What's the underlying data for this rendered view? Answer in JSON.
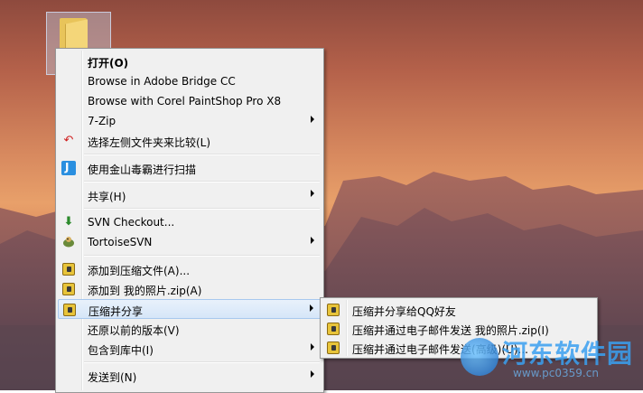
{
  "menu": {
    "items": [
      {
        "label": "打开(O)",
        "bold": true
      },
      {
        "label": "Browse in Adobe Bridge CC"
      },
      {
        "label": "Browse with Corel PaintShop Pro X8"
      },
      {
        "label": "7-Zip",
        "submenu": true
      },
      {
        "label": "选择左侧文件夹来比较(L)",
        "icon": "compare-icon"
      },
      {
        "label": "使用金山毒霸进行扫描",
        "icon": "scan-icon"
      },
      {
        "label": "共享(H)",
        "submenu": true
      },
      {
        "label": "SVN Checkout...",
        "icon": "svn-checkout-icon"
      },
      {
        "label": "TortoiseSVN",
        "icon": "tortoise-icon",
        "submenu": true
      },
      {
        "label": "添加到压缩文件(A)...",
        "icon": "zip-icon"
      },
      {
        "label": "添加到 我的照片.zip(A)",
        "icon": "zip-icon"
      },
      {
        "label": "压缩并分享",
        "icon": "zip-icon",
        "submenu": true,
        "highlighted": true
      },
      {
        "label": "还原以前的版本(V)"
      },
      {
        "label": "包含到库中(I)",
        "submenu": true
      },
      {
        "label": "发送到(N)",
        "submenu": true
      }
    ]
  },
  "submenu": {
    "items": [
      {
        "label": "压缩并分享给QQ好友",
        "icon": "zip-icon"
      },
      {
        "label": "压缩并通过电子邮件发送 我的照片.zip(I)",
        "icon": "zip-icon"
      },
      {
        "label": "压缩并通过电子邮件发送(高级)(U)...",
        "icon": "zip-icon"
      }
    ]
  },
  "watermark": {
    "title": "河东软件园",
    "url": "www.pc0359.cn"
  },
  "colors": {
    "menu_bg": "#f0f0f0",
    "highlight": "#d6e6f8",
    "highlight_border": "#a8c8ee"
  }
}
